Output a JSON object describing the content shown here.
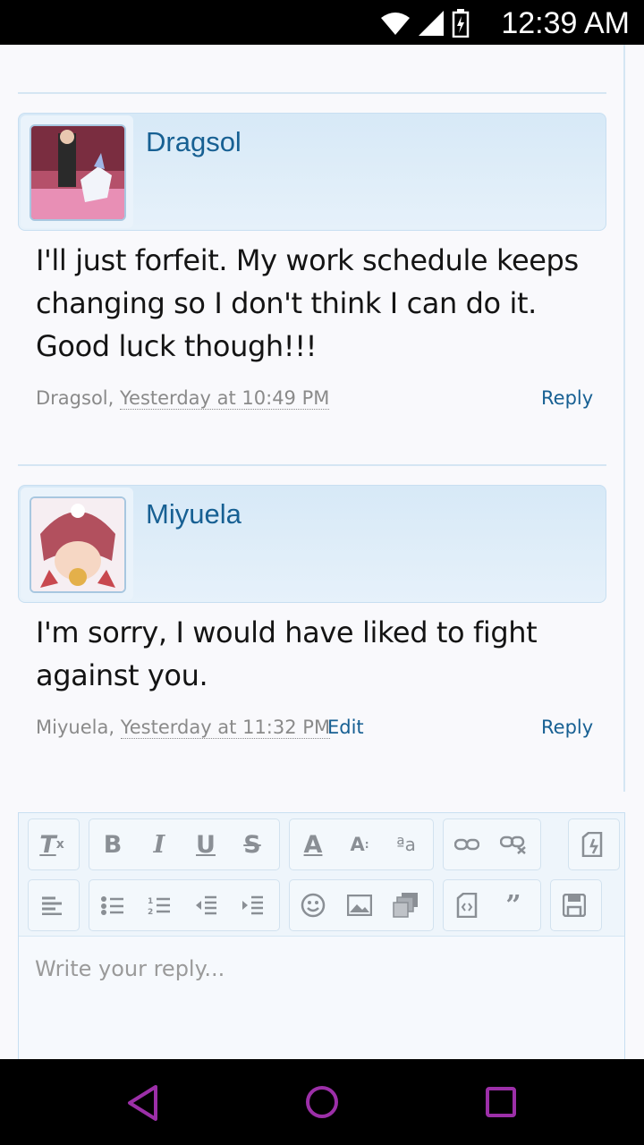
{
  "status_bar": {
    "time": "12:39 AM"
  },
  "posts": [
    {
      "username": "Dragsol",
      "message": "I'll just forfeit. My work schedule keeps changing so I don't think I can do it. Good luck though!!!",
      "author": "Dragsol,",
      "time": "Yesterday at 10:49 PM",
      "reply_label": "Reply"
    },
    {
      "username": "Miyuela",
      "message": "I'm sorry, I would have liked to fight against you.",
      "author": "Miyuela,",
      "time": "Yesterday at 11:32 PM",
      "edit_label": "Edit",
      "reply_label": "Reply"
    }
  ],
  "editor": {
    "placeholder": "Write your reply...",
    "row1_icons": [
      "remove-format-icon",
      "bold-icon",
      "italic-icon",
      "underline-icon",
      "strikethrough-icon",
      "text-color-icon",
      "font-size-icon",
      "font-family-icon",
      "link-icon",
      "unlink-icon",
      "toggle-bbcode-icon"
    ],
    "row2_icons": [
      "align-icon",
      "bulleted-list-icon",
      "numbered-list-icon",
      "outdent-icon",
      "indent-icon",
      "smilies-icon",
      "image-icon",
      "media-icon",
      "code-icon",
      "quote-icon",
      "save-draft-icon"
    ]
  },
  "nav_bar": {
    "icons": [
      "back-icon",
      "home-icon",
      "recents-icon"
    ]
  },
  "colors": {
    "link": "#176093",
    "accent": "#d7e9f7",
    "nav_icon": "#9c2fa8"
  }
}
